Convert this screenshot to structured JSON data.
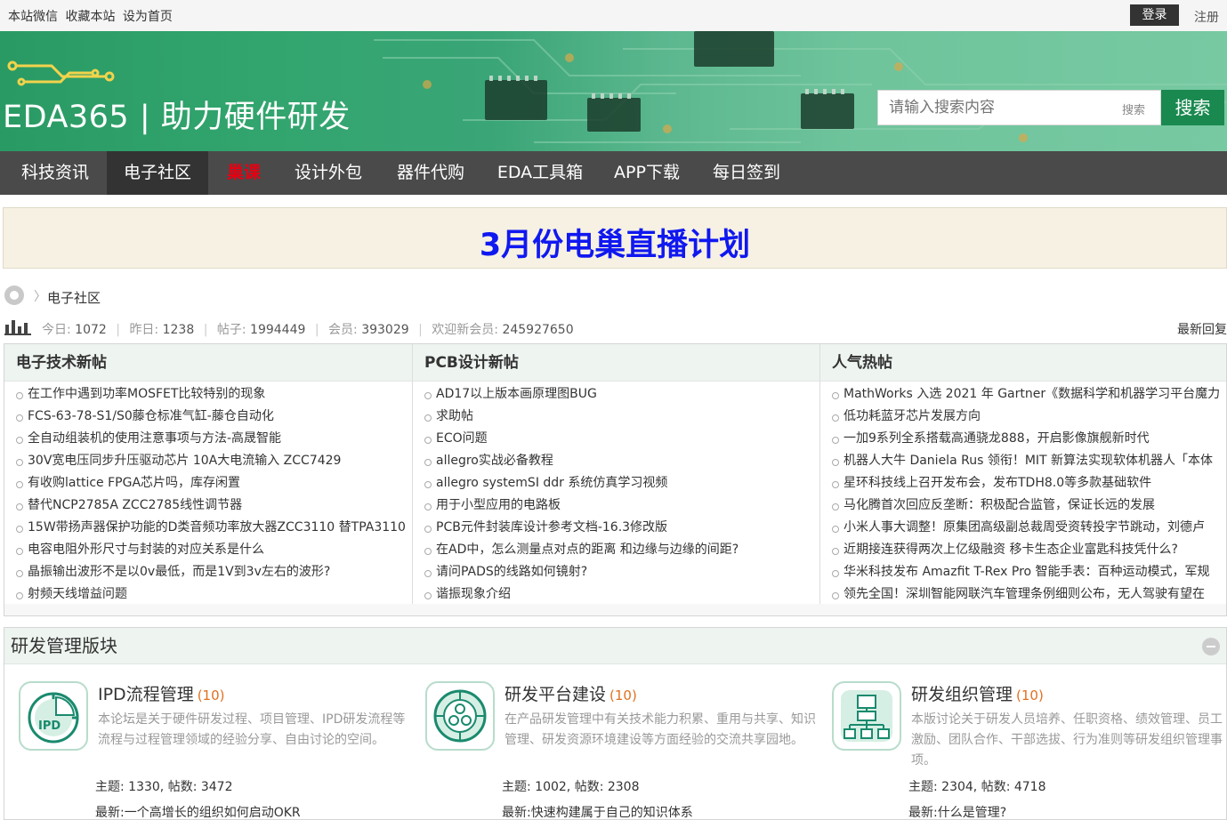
{
  "topbar": {
    "links": [
      "本站微信",
      "收藏本站",
      "设为首页"
    ],
    "login": "登录",
    "register": "注册"
  },
  "header": {
    "logo_text": "EDA365 | 助力硬件研发",
    "search_placeholder": "请输入搜索内容",
    "search_small": "搜索",
    "search_button": "搜索"
  },
  "nav": {
    "items": [
      {
        "label": "科技资讯"
      },
      {
        "label": "电子社区"
      },
      {
        "label": "巢课"
      },
      {
        "label": "设计外包"
      },
      {
        "label": "器件代购"
      },
      {
        "label": "EDA工具箱"
      },
      {
        "label": "APP下载"
      },
      {
        "label": "每日签到"
      }
    ]
  },
  "promo": {
    "text": "3月份电巢直播计划"
  },
  "breadcrumb": {
    "current": "电子社区"
  },
  "stats": {
    "today_label": "今日:",
    "today": "1072",
    "yesterday_label": "昨日:",
    "yesterday": "1238",
    "posts_label": "帖子:",
    "posts": "1994449",
    "members_label": "会员:",
    "members": "393029",
    "welcome_label": "欢迎新会员:",
    "welcome": "245927650",
    "latest_reply": "最新回复"
  },
  "columns": [
    {
      "title": "电子技术新帖",
      "items": [
        "在工作中遇到功率MOSFET比较特别的现象",
        "FCS-63-78-S1/S0藤仓标准气缸-藤仓自动化",
        "全自动组装机的使用注意事项与方法-高晟智能",
        "30V宽电压同步升压驱动芯片 10A大电流输入 ZCC7429",
        "有收购lattice FPGA芯片吗，库存闲置",
        "替代NCP2785A ZCC2785线性调节器",
        "15W带扬声器保护功能的D类音频功率放大器ZCC3110 替TPA3110",
        "电容电阻外形尺寸与封装的对应关系是什么",
        "晶振输出波形不是以0v最低，而是1V到3v左右的波形?",
        "射频天线增益问题"
      ]
    },
    {
      "title": "PCB设计新帖",
      "items": [
        "AD17以上版本画原理图BUG",
        "求助帖",
        "ECO问题",
        "allegro实战必备教程",
        "allegro systemSI ddr 系统仿真学习视频",
        "用于小型应用的电路板",
        "PCB元件封装库设计参考文档-16.3修改版",
        "在AD中，怎么测量点对点的距离 和边缘与边缘的间距?",
        "请问PADS的线路如何镜射?",
        "谐振现象介绍"
      ]
    },
    {
      "title": "人气热帖",
      "items": [
        "MathWorks 入选 2021 年 Gartner《数据科学和机器学习平台魔力",
        "低功耗蓝牙芯片发展方向",
        "一加9系列全系搭载高通骁龙888，开启影像旗舰新时代",
        "机器人大牛 Daniela Rus 领衔！MIT 新算法实现软体机器人「本体",
        "星环科技线上召开发布会，发布TDH8.0等多款基础软件",
        "马化腾首次回应反垄断：积极配合监管，保证长远的发展",
        "小米人事大调整！原集团高级副总裁周受资转投字节跳动，刘德卢",
        "近期接连获得两次上亿级融资 移卡生态企业富匙科技凭什么?",
        "华米科技发布 Amazfit T-Rex Pro 智能手表：百种运动模式，军规",
        "领先全国！深圳智能网联汽车管理条例细则公布，无人驾驶有望在"
      ]
    }
  ],
  "forum_section": {
    "title": "研发管理版块",
    "boards": [
      {
        "icon": "ipd-pie-icon",
        "name": "IPD流程管理",
        "count": "(10)",
        "desc": "本论坛是关于硬件研发过程、项目管理、IPD研发流程等流程与过程管理领域的经验分享、自由讨论的空间。",
        "meta": "主题: 1330, 帖数: 3472",
        "latest": "最新:一个高增长的组织如何启动OKR"
      },
      {
        "icon": "platform-network-icon",
        "name": "研发平台建设",
        "count": "(10)",
        "desc": "在产品研发管理中有关技术能力积累、重用与共享、知识管理、研发资源环境建设等方面经验的交流共享园地。",
        "meta": "主题: 1002, 帖数: 2308",
        "latest": "最新:快速构建属于自己的知识体系"
      },
      {
        "icon": "org-chart-icon",
        "name": "研发组织管理",
        "count": "(10)",
        "desc": "本版讨论关于研发人员培养、任职资格、绩效管理、员工激励、团队合作、干部选拔、行为准则等研发组织管理事项。",
        "meta": "主题: 2304, 帖数: 4718",
        "latest": "最新:什么是管理?"
      }
    ]
  },
  "colors": {
    "brand_green": "#19894f",
    "nav_bg": "#4a4a4a",
    "promo_blue": "#1018f0",
    "hot_red": "#e60012",
    "count_orange": "#e07020"
  }
}
